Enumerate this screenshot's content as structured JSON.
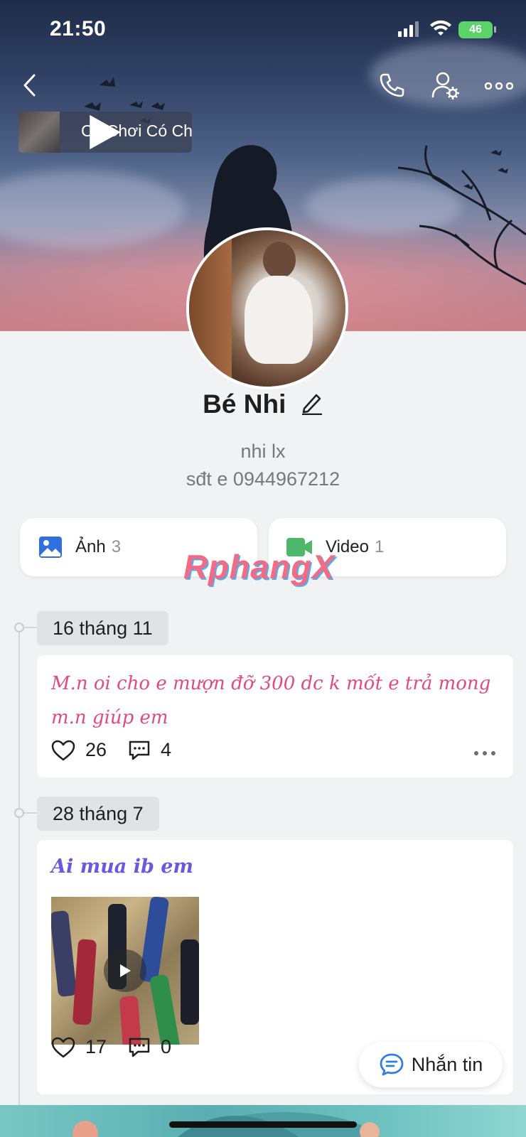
{
  "status_bar": {
    "time": "21:50",
    "battery": "46"
  },
  "music": {
    "title": "Có Chơi Có Chịu"
  },
  "profile": {
    "name": "Bé Nhi",
    "bio_line1": "nhi lx",
    "bio_line2": "sđt e 0944967212"
  },
  "media": {
    "photos": {
      "label": "Ảnh",
      "count": "3"
    },
    "videos": {
      "label": "Video",
      "count": "1"
    }
  },
  "watermark": "RphangX",
  "timeline": [
    {
      "date": "16 tháng 11",
      "text": "M.n oi cho e mượn đỡ 300 dc k mốt e trả mong m.n giúp em",
      "likes": "26",
      "comments": "4"
    },
    {
      "date": "28 tháng 7",
      "text": "Ai mua ib em",
      "likes": "17",
      "comments": "0"
    }
  ],
  "message_button": "Nhắn tin",
  "icons": {
    "back": "chevron-left-icon",
    "call": "phone-icon",
    "settings": "user-settings-icon",
    "more": "more-horizontal-icon",
    "photo": "image-icon",
    "video": "video-camera-icon",
    "like": "heart-icon",
    "comment": "comment-icon",
    "message": "chat-bubble-icon"
  },
  "colors": {
    "photo_icon": "#2f6fe0",
    "video_icon": "#4db869",
    "post1_text": "#e24b7d",
    "post2_text": "#6b58e0",
    "message_icon": "#2f7fe0"
  }
}
